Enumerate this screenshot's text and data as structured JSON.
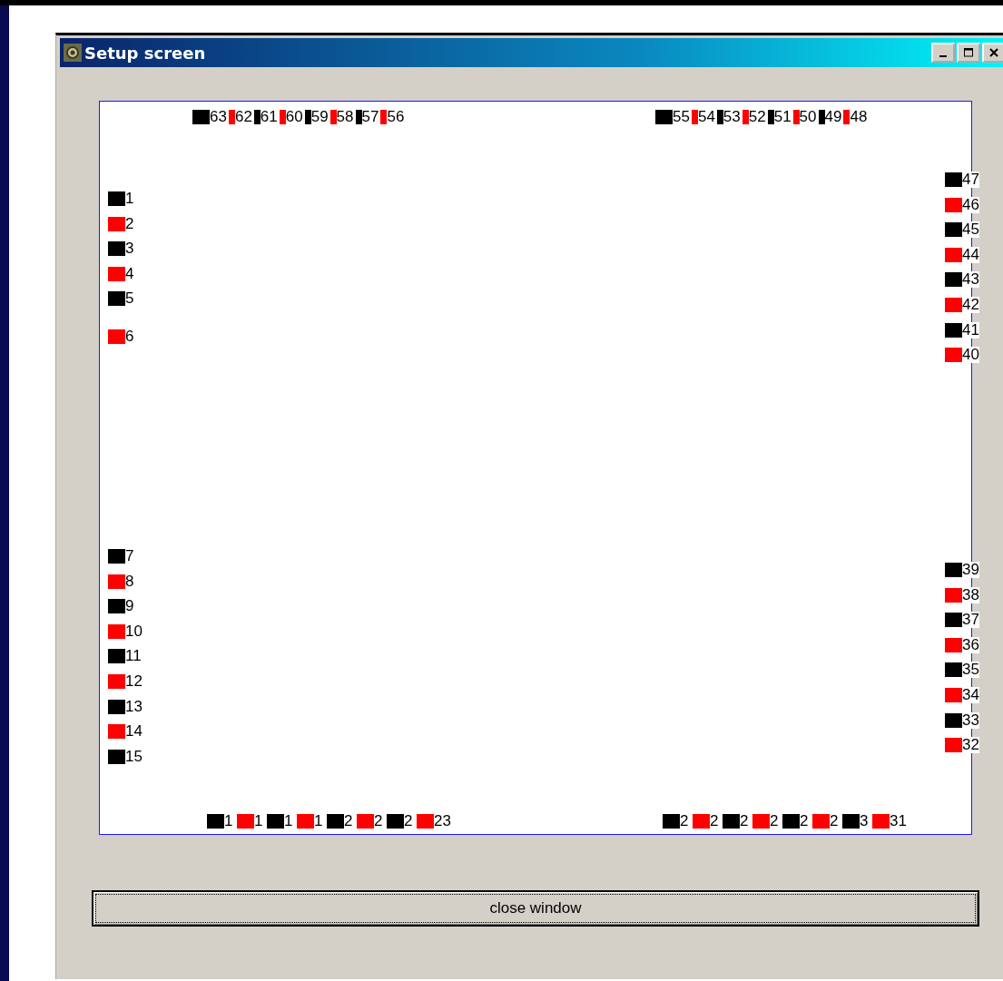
{
  "window": {
    "title": "Setup screen"
  },
  "pins": {
    "top": [
      {
        "pins": [
          {
            "label": "63",
            "color": "#000000"
          },
          {
            "label": "62",
            "color": "#ff0000"
          },
          {
            "label": "61",
            "color": "#000000"
          },
          {
            "label": "60",
            "color": "#ff0000"
          },
          {
            "label": "59",
            "color": "#000000"
          },
          {
            "label": "58",
            "color": "#ff0000"
          },
          {
            "label": "57",
            "color": "#000000"
          },
          {
            "label": "56",
            "color": "#ff0000"
          }
        ]
      },
      {
        "pins": [
          {
            "label": "55",
            "color": "#000000"
          },
          {
            "label": "54",
            "color": "#ff0000"
          },
          {
            "label": "53",
            "color": "#000000"
          },
          {
            "label": "52",
            "color": "#ff0000"
          },
          {
            "label": "51",
            "color": "#000000"
          },
          {
            "label": "50",
            "color": "#ff0000"
          },
          {
            "label": "49",
            "color": "#000000"
          },
          {
            "label": "48",
            "color": "#ff0000"
          }
        ]
      }
    ],
    "left": [
      {
        "pins": [
          {
            "label": "1",
            "color": "#000000"
          },
          {
            "label": "2",
            "color": "#ff0000"
          },
          {
            "label": "3",
            "color": "#000000"
          },
          {
            "label": "4",
            "color": "#ff0000"
          },
          {
            "label": "5",
            "color": "#000000"
          },
          {
            "label": "6",
            "color": "#ff0000"
          }
        ]
      },
      {
        "pins": [
          {
            "label": "7",
            "color": "#000000"
          },
          {
            "label": "8",
            "color": "#ff0000"
          },
          {
            "label": "9",
            "color": "#000000"
          },
          {
            "label": "10",
            "color": "#ff0000"
          },
          {
            "label": "11",
            "color": "#000000"
          },
          {
            "label": "12",
            "color": "#ff0000"
          },
          {
            "label": "13",
            "color": "#000000"
          },
          {
            "label": "14",
            "color": "#ff0000"
          },
          {
            "label": "15",
            "color": "#000000"
          }
        ]
      }
    ],
    "right": [
      {
        "pins": [
          {
            "label": "47",
            "color": "#000000"
          },
          {
            "label": "46",
            "color": "#ff0000"
          },
          {
            "label": "45",
            "color": "#000000"
          },
          {
            "label": "44",
            "color": "#ff0000"
          },
          {
            "label": "43",
            "color": "#000000"
          },
          {
            "label": "42",
            "color": "#ff0000"
          },
          {
            "label": "41",
            "color": "#000000"
          },
          {
            "label": "40",
            "color": "#ff0000"
          }
        ]
      },
      {
        "pins": [
          {
            "label": "39",
            "color": "#000000"
          },
          {
            "label": "38",
            "color": "#ff0000"
          },
          {
            "label": "37",
            "color": "#000000"
          },
          {
            "label": "36",
            "color": "#ff0000"
          },
          {
            "label": "35",
            "color": "#000000"
          },
          {
            "label": "34",
            "color": "#ff0000"
          },
          {
            "label": "33",
            "color": "#000000"
          },
          {
            "label": "32",
            "color": "#ff0000"
          }
        ]
      }
    ],
    "bottom": [
      {
        "pins": [
          {
            "label": "1",
            "color": "#000000"
          },
          {
            "label": "1",
            "color": "#ff0000"
          },
          {
            "label": "1",
            "color": "#000000"
          },
          {
            "label": "1",
            "color": "#ff0000"
          },
          {
            "label": "2",
            "color": "#000000"
          },
          {
            "label": "2",
            "color": "#ff0000"
          },
          {
            "label": "2",
            "color": "#000000"
          },
          {
            "label": "23",
            "color": "#ff0000"
          }
        ]
      },
      {
        "pins": [
          {
            "label": "2",
            "color": "#000000"
          },
          {
            "label": "2",
            "color": "#ff0000"
          },
          {
            "label": "2",
            "color": "#000000"
          },
          {
            "label": "2",
            "color": "#ff0000"
          },
          {
            "label": "2",
            "color": "#000000"
          },
          {
            "label": "2",
            "color": "#ff0000"
          },
          {
            "label": "3",
            "color": "#000000"
          },
          {
            "label": "31",
            "color": "#ff0000"
          }
        ]
      }
    ]
  },
  "close_button": "close window"
}
